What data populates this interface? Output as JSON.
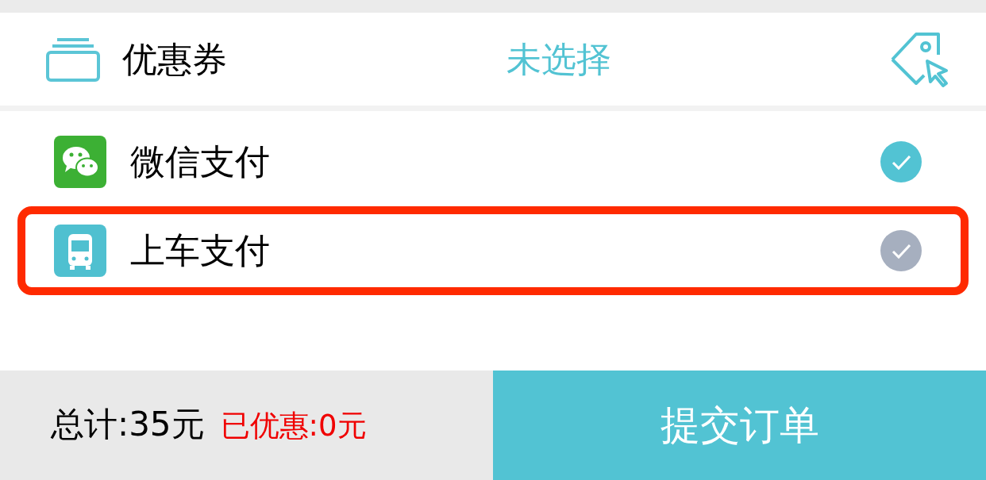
{
  "coupon": {
    "label": "优惠券",
    "value": "未选择"
  },
  "payments": [
    {
      "kind": "wechat",
      "label": "微信支付",
      "selected": true,
      "highlighted": false
    },
    {
      "kind": "bus",
      "label": "上车支付",
      "selected": false,
      "highlighted": true
    }
  ],
  "footer": {
    "total": "总计:35元",
    "discount": "已优惠:0元",
    "submit": "提交订单"
  }
}
